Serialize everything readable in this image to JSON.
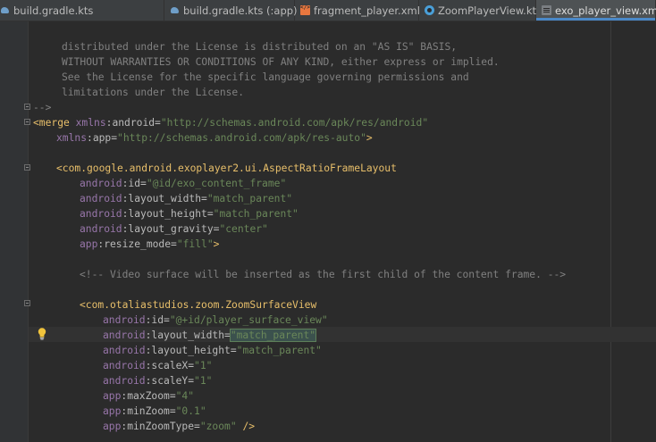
{
  "tabs": [
    {
      "label": "build.gradle.kts",
      "icon": "gradle-icon",
      "active": false,
      "closable": false
    },
    {
      "label": "build.gradle.kts (:app)",
      "icon": "gradle-icon",
      "active": false,
      "closable": true
    },
    {
      "label": "fragment_player.xml",
      "icon": "xml-layout-icon",
      "active": false,
      "closable": true
    },
    {
      "label": "ZoomPlayerView.kt",
      "icon": "kotlin-class-icon",
      "active": false,
      "closable": true
    },
    {
      "label": "exo_player_view.xml",
      "icon": "xml-file-icon",
      "active": true,
      "closable": true
    }
  ],
  "close_glyph": "×",
  "code": {
    "license_lines": [
      "distributed under the License is distributed on an \"AS IS\" BASIS,",
      "WITHOUT WARRANTIES OR CONDITIONS OF ANY KIND, either express or implied.",
      "See the License for the specific language governing permissions and",
      "limitations under the License."
    ],
    "comment_end": "-->",
    "merge_tag": "<merge",
    "xmlns_android_ns": "xmlns",
    "xmlns_android_name": ":android=",
    "xmlns_android_value": "\"http://schemas.android.com/apk/res/android\"",
    "xmlns_app_ns": "xmlns",
    "xmlns_app_name": ":app=",
    "xmlns_app_value": "\"http://schemas.android.com/apk/res-auto\"",
    "xmlns_app_close": ">",
    "frame_tag": "<com.google.android.exoplayer2.ui.AspectRatioFrameLayout",
    "frame_attrs": [
      {
        "ns": "android",
        "name": ":id=",
        "value": "\"@id/exo_content_frame\"",
        "close": ""
      },
      {
        "ns": "android",
        "name": ":layout_width=",
        "value": "\"match_parent\"",
        "close": ""
      },
      {
        "ns": "android",
        "name": ":layout_height=",
        "value": "\"match_parent\"",
        "close": ""
      },
      {
        "ns": "android",
        "name": ":layout_gravity=",
        "value": "\"center\"",
        "close": ""
      },
      {
        "ns": "app",
        "name": ":resize_mode=",
        "value": "\"fill\"",
        "close": ">"
      }
    ],
    "inner_comment": "<!-- Video surface will be inserted as the first child of the content frame. -->",
    "surface_tag": "<com.otaliastudios.zoom.ZoomSurfaceView",
    "surface_attrs": [
      {
        "ns": "android",
        "name": ":id=",
        "value": "\"@+id/player_surface_view\"",
        "close": ""
      },
      {
        "ns": "android",
        "name": ":layout_width=",
        "value": "\"match_parent\"",
        "close": ""
      },
      {
        "ns": "android",
        "name": ":layout_height=",
        "value": "\"match_parent\"",
        "close": ""
      },
      {
        "ns": "android",
        "name": ":scaleX=",
        "value": "\"1\"",
        "close": ""
      },
      {
        "ns": "android",
        "name": ":scaleY=",
        "value": "\"1\"",
        "close": ""
      },
      {
        "ns": "app",
        "name": ":maxZoom=",
        "value": "\"4\"",
        "close": ""
      },
      {
        "ns": "app",
        "name": ":minZoom=",
        "value": "\"0.1\"",
        "close": ""
      },
      {
        "ns": "app",
        "name": ":minZoomType=",
        "value": "\"zoom\"",
        "close": " />"
      }
    ]
  }
}
